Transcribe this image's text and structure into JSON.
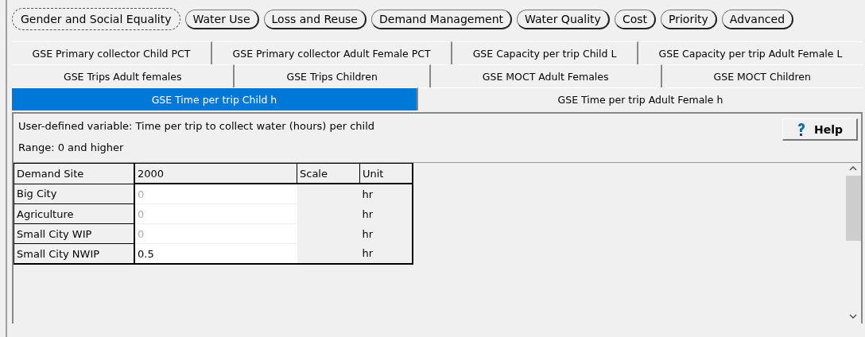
{
  "categories": [
    {
      "label": "Gender and Social Equality",
      "selected": true
    },
    {
      "label": "Water Use",
      "selected": false
    },
    {
      "label": "Loss and Reuse",
      "selected": false
    },
    {
      "label": "Demand Management",
      "selected": false
    },
    {
      "label": "Water Quality",
      "selected": false
    },
    {
      "label": "Cost",
      "selected": false
    },
    {
      "label": "Priority",
      "selected": false
    },
    {
      "label": "Advanced",
      "selected": false
    }
  ],
  "tab_rows": [
    [
      {
        "label": "GSE Primary collector Child PCT",
        "selected": false
      },
      {
        "label": "GSE Primary collector Adult Female PCT",
        "selected": false
      },
      {
        "label": "GSE Capacity per trip Child L",
        "selected": false
      },
      {
        "label": "GSE Capacity per trip Adult Female L",
        "selected": false
      }
    ],
    [
      {
        "label": "GSE Trips Adult females",
        "selected": false
      },
      {
        "label": "GSE Trips Children",
        "selected": false
      },
      {
        "label": "GSE MOCT Adult Females",
        "selected": false
      },
      {
        "label": "GSE MOCT Children",
        "selected": false
      }
    ],
    [
      {
        "label": "GSE Time per trip Child h",
        "selected": true
      },
      {
        "label": "GSE Time per trip Adult Female h",
        "selected": false
      }
    ]
  ],
  "description": "User-defined variable: Time per trip to collect water (hours) per child",
  "range": "Range: 0 and higher",
  "help_button": "Help",
  "table": {
    "columns": [
      "Demand Site",
      "2000",
      "Scale",
      "Unit"
    ],
    "rows": [
      {
        "site": "Big City",
        "value": "0",
        "disabled": true,
        "unit": "hr"
      },
      {
        "site": "Agriculture",
        "value": "0",
        "disabled": true,
        "unit": "hr"
      },
      {
        "site": "Small City WIP",
        "value": "0",
        "disabled": true,
        "unit": "hr"
      },
      {
        "site": "Small City NWIP",
        "value": "0.5",
        "disabled": false,
        "unit": "hr"
      }
    ]
  }
}
